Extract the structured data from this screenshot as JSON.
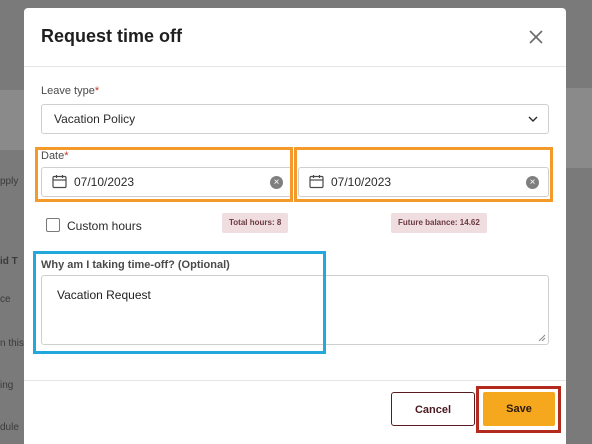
{
  "background": {
    "fragments": [
      "pply",
      "id T",
      "ce",
      "n this",
      "ing",
      "dule"
    ]
  },
  "modal": {
    "title": "Request time off"
  },
  "leave_type": {
    "label": "Leave type",
    "required_mark": "*",
    "value": "Vacation Policy"
  },
  "date": {
    "label": "Date",
    "required_mark": "*",
    "start_value": "07/10/2023",
    "end_value": "07/10/2023"
  },
  "custom_hours": {
    "label": "Custom hours",
    "checked": false
  },
  "badges": {
    "total_hours": "Total hours: 8",
    "future_balance": "Future balance: 14.62"
  },
  "reason": {
    "label": "Why am I taking time-off? (Optional)",
    "value": "Vacation Request"
  },
  "footer": {
    "cancel_label": "Cancel",
    "save_label": "Save"
  },
  "colors": {
    "accent_save": "#f5a71e",
    "highlight_orange": "#f39a2a",
    "highlight_blue": "#23a8de",
    "highlight_red": "#b32a1e"
  }
}
